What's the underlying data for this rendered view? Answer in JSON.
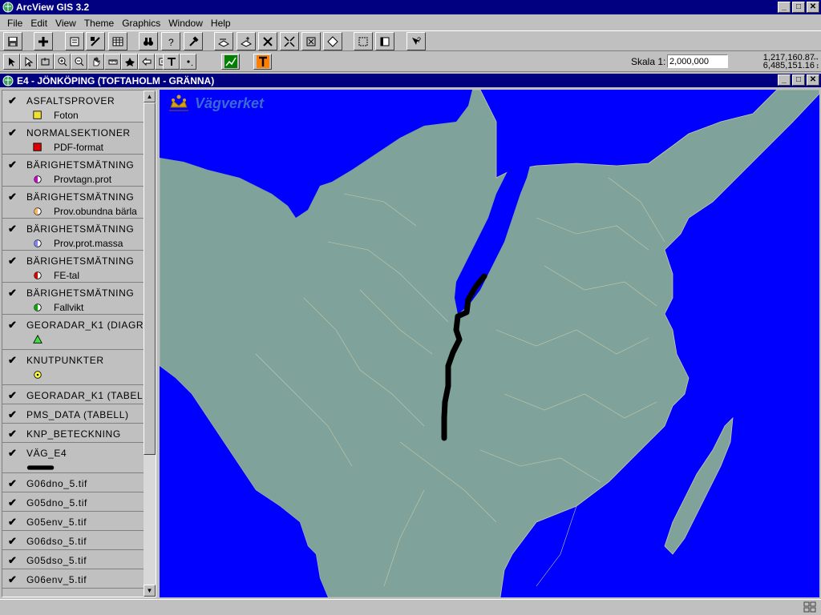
{
  "app": {
    "title": "ArcView GIS 3.2"
  },
  "menu": [
    "File",
    "Edit",
    "View",
    "Theme",
    "Graphics",
    "Window",
    "Help"
  ],
  "toolbar": {
    "scale_label": "Skala 1:",
    "scale_value": "2,000,000",
    "coord_x": "1,217,160.87",
    "coord_y": "6,485,151.16"
  },
  "view": {
    "title": "E4 - JÖNKÖPING (TOFTAHOLM - GRÄNNA)"
  },
  "map": {
    "brand": "Vägverket"
  },
  "colors": {
    "water": "#0000ff",
    "land": "#7fa39a",
    "border": "#c8c8a8",
    "road": "#000000"
  },
  "legend": [
    {
      "name": "ASFALTSPROVER",
      "label": "Foton",
      "symbol": "square-yellow"
    },
    {
      "name": "NORMALSEKTIONER",
      "label": "PDF-format",
      "symbol": "square-red"
    },
    {
      "name": "BÄRIGHETSMÄTNING",
      "label": "Provtagn.prot",
      "symbol": "half-circle-magenta"
    },
    {
      "name": "BÄRIGHETSMÄTNING",
      "label": "Prov.obundna bärla",
      "symbol": "half-circle-orange"
    },
    {
      "name": "BÄRIGHETSMÄTNING",
      "label": "Prov.prot.massa",
      "symbol": "half-circle-blue"
    },
    {
      "name": "BÄRIGHETSMÄTNING",
      "label": "FE-tal",
      "symbol": "half-circle-red"
    },
    {
      "name": "BÄRIGHETSMÄTNING",
      "label": "Fallvikt",
      "symbol": "half-circle-green"
    },
    {
      "name": "GEORADAR_K1 (DIAGR",
      "label": "",
      "symbol": "triangle-green"
    },
    {
      "name": "KNUTPUNKTER",
      "label": "",
      "symbol": "circle-dot-yellow"
    },
    {
      "name": "GEORADAR_K1 (TABELL",
      "label": "",
      "symbol": "none"
    },
    {
      "name": "PMS_DATA (TABELL)",
      "label": "",
      "symbol": "none"
    },
    {
      "name": "KNP_BETECKNING",
      "label": "",
      "symbol": "none"
    },
    {
      "name": "VÄG_E4",
      "label": "",
      "symbol": "line-black"
    },
    {
      "name": "G06dno_5.tif",
      "label": "",
      "symbol": "none"
    },
    {
      "name": "G05dno_5.tif",
      "label": "",
      "symbol": "none"
    },
    {
      "name": "G05env_5.tif",
      "label": "",
      "symbol": "none"
    },
    {
      "name": "G06dso_5.tif",
      "label": "",
      "symbol": "none"
    },
    {
      "name": "G05dso_5.tif",
      "label": "",
      "symbol": "none"
    },
    {
      "name": "G06env_5.tif",
      "label": "",
      "symbol": "none"
    }
  ]
}
